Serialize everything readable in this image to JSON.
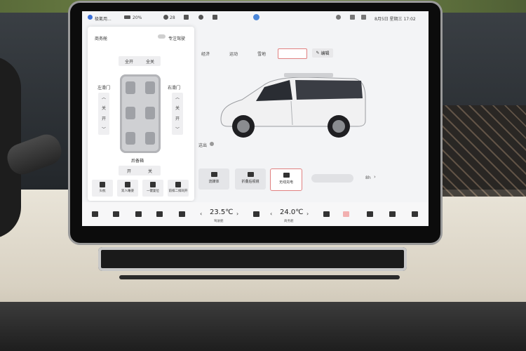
{
  "status": {
    "app": "极氪用...",
    "battery": "20%",
    "temp_a": "28",
    "date": "8月5日 星期三 17:02"
  },
  "modes": [
    "经济",
    "运动",
    "雪地"
  ],
  "edit_label": "编辑",
  "hint": "这出",
  "cards": [
    "流媒体",
    "折叠后视镜",
    "无线充电"
  ],
  "side_text": "8h",
  "panel": {
    "title": "商务舱",
    "toggle_label": "专注驾驶",
    "all_open": "全开",
    "all_close": "全关",
    "left_door": "左滑门",
    "right_door": "右滑门",
    "door_close": "关",
    "door_open": "开",
    "trunk": "后备箱",
    "trunk_open": "开",
    "trunk_close": "关",
    "quick_buttons": [
      "头枕",
      "双人睡姿",
      "一键复位",
      "前排二排同开"
    ]
  },
  "bottombar": {
    "left_temp": "23.5℃",
    "left_label": "驾驶舱",
    "right_temp": "24.0℃",
    "right_label": "商务舱"
  }
}
